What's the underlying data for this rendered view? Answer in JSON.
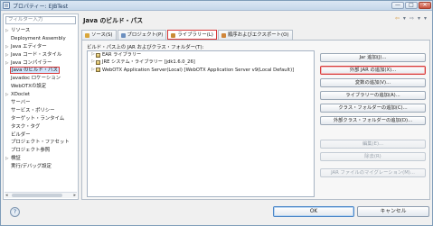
{
  "window": {
    "title": "プロパティー: EJBTest",
    "minimize_label": "—",
    "maximize_label": "□",
    "close_label": "✕"
  },
  "filter": {
    "placeholder": "フィルター入力"
  },
  "tree": [
    {
      "label": "リソース",
      "expandable": true,
      "indent": 0,
      "selected": false
    },
    {
      "label": "Deployment Assembly",
      "expandable": false,
      "indent": 1,
      "selected": false
    },
    {
      "label": "Java エディター",
      "expandable": true,
      "indent": 0,
      "selected": false
    },
    {
      "label": "Java コード・スタイル",
      "expandable": true,
      "indent": 0,
      "selected": false
    },
    {
      "label": "Java コンパイラー",
      "expandable": true,
      "indent": 0,
      "selected": false
    },
    {
      "label": "Java のビルド・パス",
      "expandable": false,
      "indent": 1,
      "selected": true
    },
    {
      "label": "Javadoc ロケーション",
      "expandable": false,
      "indent": 1,
      "selected": false
    },
    {
      "label": "WebOTXの設定",
      "expandable": false,
      "indent": 1,
      "selected": false
    },
    {
      "label": "XDoclet",
      "expandable": true,
      "indent": 0,
      "selected": false
    },
    {
      "label": "サーバー",
      "expandable": false,
      "indent": 1,
      "selected": false
    },
    {
      "label": "サービス・ポリシー",
      "expandable": false,
      "indent": 1,
      "selected": false
    },
    {
      "label": "ターゲット・ランタイム",
      "expandable": false,
      "indent": 1,
      "selected": false
    },
    {
      "label": "タスク・タグ",
      "expandable": false,
      "indent": 1,
      "selected": false
    },
    {
      "label": "ビルダー",
      "expandable": false,
      "indent": 1,
      "selected": false
    },
    {
      "label": "プロジェクト・ファセット",
      "expandable": false,
      "indent": 1,
      "selected": false
    },
    {
      "label": "プロジェクト参照",
      "expandable": false,
      "indent": 1,
      "selected": false
    },
    {
      "label": "検証",
      "expandable": true,
      "indent": 0,
      "selected": false
    },
    {
      "label": "実行/デバッグ設定",
      "expandable": false,
      "indent": 1,
      "selected": false
    }
  ],
  "page": {
    "title": "Java のビルド・パス",
    "nav_back": "⇦",
    "nav_back_menu": "▾",
    "nav_fwd": "⇨",
    "nav_fwd_menu": "▾",
    "menu": "▾"
  },
  "tabs": [
    {
      "label": "ソース(S)",
      "active": false,
      "color": "#d9a63b"
    },
    {
      "label": "プロジェクト(P)",
      "active": false,
      "color": "#6b8fbf"
    },
    {
      "label": "ライブラリー(L)",
      "active": true,
      "color": "#c98b35"
    },
    {
      "label": "順序およびエクスポート(O)",
      "active": false,
      "color": "#d0863a"
    }
  ],
  "libraries_label": "ビルド・パス上の JAR およびクラス・フォルダー(T):",
  "libraries": [
    {
      "label": "EAR ライブラリー"
    },
    {
      "label": "JRE システム・ライブラリー [jdk1.6.0_26]"
    },
    {
      "label": "WebOTX Application Server(Local) [WebOTX Application Server v9(Local Default)]"
    }
  ],
  "buttons": [
    {
      "label": "Jar 追加(J)...",
      "state": "normal"
    },
    {
      "label": "外部 JAR の追加(X)...",
      "state": "highlight"
    },
    {
      "label": "変数の追加(V)...",
      "state": "normal"
    },
    {
      "label": "ライブラリーの追加(A)...",
      "state": "normal"
    },
    {
      "label": "クラス・フォルダーの追加(C)...",
      "state": "normal"
    },
    {
      "label": "外部クラス・フォルダーの追加(D)...",
      "state": "normal"
    },
    {
      "label": "編集(E)...",
      "state": "disabled"
    },
    {
      "label": "除去(R)",
      "state": "disabled"
    },
    {
      "label": "JAR ファイルのマイグレーション(M)...",
      "state": "disabled"
    }
  ],
  "footer": {
    "help": "?",
    "ok": "OK",
    "cancel": "キャンセル"
  },
  "colors": {
    "highlight_outline": "#d83a3a",
    "window_border": "#7f9db9"
  }
}
